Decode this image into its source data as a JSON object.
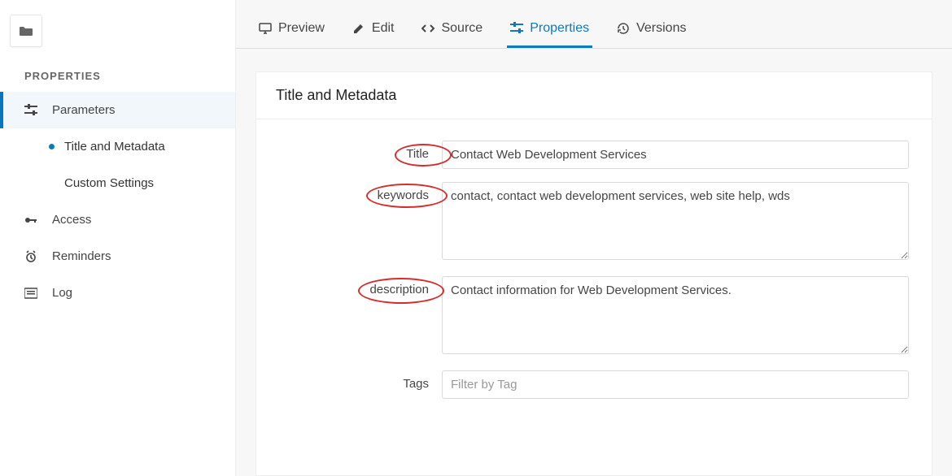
{
  "sidebar": {
    "section": "PROPERTIES",
    "parameters": "Parameters",
    "title_and_metadata": "Title and Metadata",
    "custom_settings": "Custom Settings",
    "access": "Access",
    "reminders": "Reminders",
    "log": "Log"
  },
  "tabs": {
    "preview": "Preview",
    "edit": "Edit",
    "source": "Source",
    "properties": "Properties",
    "versions": "Versions"
  },
  "panel": {
    "heading": "Title and Metadata",
    "title_label": "Title",
    "title_value": "Contact Web Development Services",
    "keywords_label": "keywords",
    "keywords_value": "contact, contact web development services, web site help, wds",
    "description_label": "description",
    "description_value": "Contact information for Web Development Services.",
    "tags_label": "Tags",
    "tags_placeholder": "Filter by Tag"
  }
}
